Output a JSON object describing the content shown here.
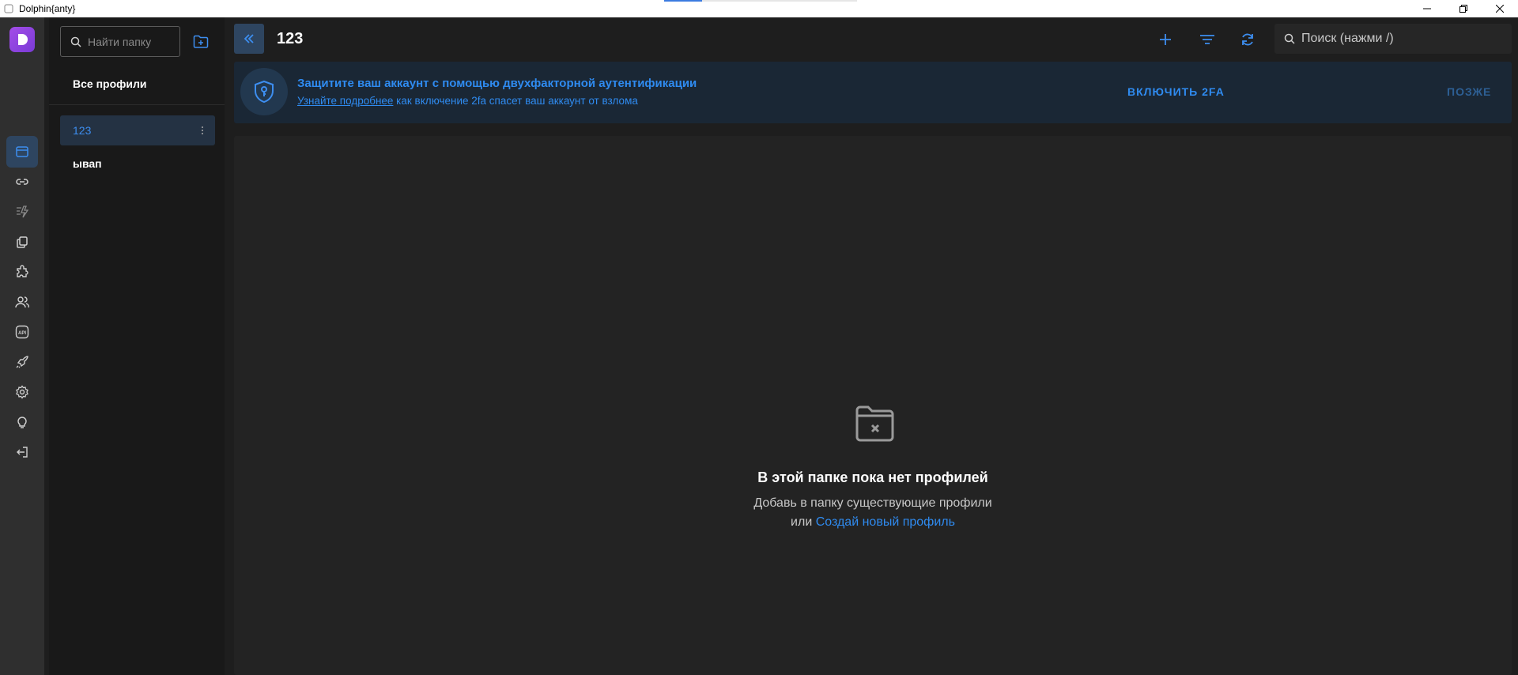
{
  "window": {
    "title": "Dolphin{anty}"
  },
  "rail": {
    "items": [
      {
        "icon": "browser-profiles-icon",
        "active": true
      },
      {
        "icon": "link-icon"
      },
      {
        "icon": "automation-icon"
      },
      {
        "icon": "copy-icon"
      },
      {
        "icon": "extensions-icon"
      },
      {
        "icon": "users-icon"
      },
      {
        "icon": "api-icon"
      },
      {
        "icon": "rocket-icon"
      },
      {
        "icon": "settings-icon"
      },
      {
        "icon": "lightbulb-icon"
      },
      {
        "icon": "logout-icon"
      }
    ],
    "api_label": "API"
  },
  "folders": {
    "search_placeholder": "Найти папку",
    "all_profiles": "Все профили",
    "items": [
      {
        "label": "123",
        "active": true
      },
      {
        "label": "ывап",
        "active": false
      }
    ]
  },
  "header": {
    "title": "123",
    "search_placeholder": "Поиск (нажми /)"
  },
  "banner": {
    "title": "Защитите ваш аккаунт с помощью двухфакторной аутентификации",
    "learn_more": "Узнайте подробнее",
    "subtitle_rest": " как включение 2fa спасет ваш аккаунт от взлома",
    "enable_button": "ВКЛЮЧИТЬ 2FA",
    "later_button": "ПОЗЖЕ"
  },
  "empty_state": {
    "title": "В этой папке пока нет профилей",
    "line1": "Добавь в папку существующие профили",
    "line2_prefix": "или ",
    "create_link": "Создай новый профиль"
  },
  "colors": {
    "accent": "#2f8bf0",
    "rail_bg": "#2f2f2f",
    "active_bg": "#2e4560",
    "banner_bg": "#1a2735",
    "logo": "#a34de8"
  }
}
